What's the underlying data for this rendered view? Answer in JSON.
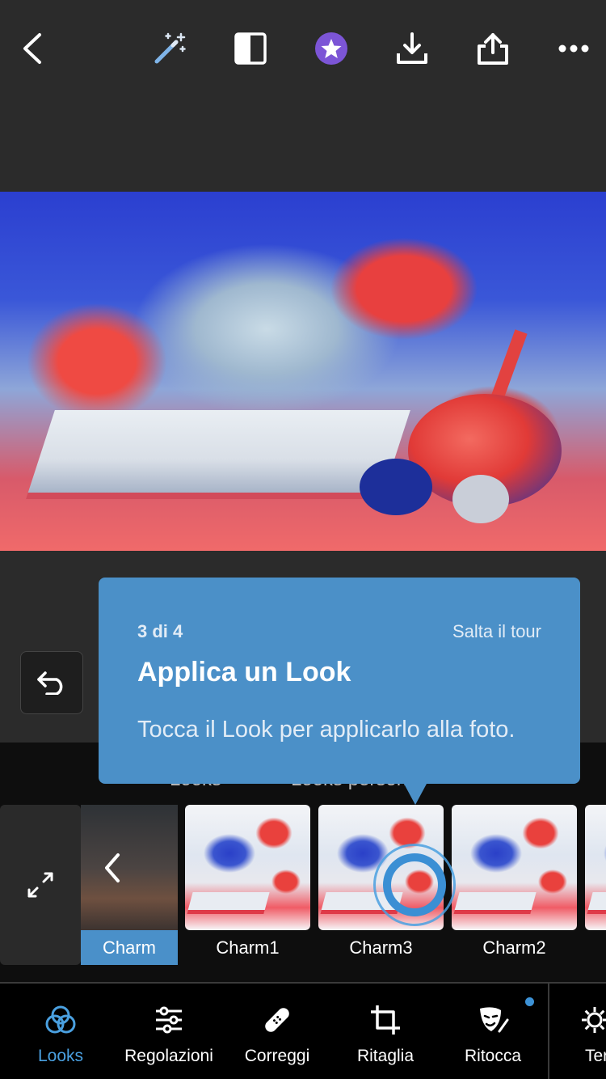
{
  "colors": {
    "accent": "#4a90c9",
    "tooltip_bg": "#4b90c8",
    "active_nav": "#4aa0e0",
    "premium": "#7c55d6"
  },
  "topbar": {
    "icons": [
      "back-icon",
      "magic-wand-icon",
      "compare-icon",
      "premium-star-icon",
      "download-icon",
      "share-icon",
      "more-icon"
    ]
  },
  "tooltip": {
    "step": "3 di 4",
    "skip": "Salta il tour",
    "title": "Applica un Look",
    "body": "Tocca il Look per applicarlo alla foto."
  },
  "looks_tabs": {
    "tab1": "Looks",
    "tab2": "Looks personali"
  },
  "looks": {
    "category": "Charm",
    "items": [
      "Charm1",
      "Charm3",
      "Charm2"
    ]
  },
  "bottom_nav": {
    "items": [
      {
        "label": "Looks",
        "icon": "looks-icon",
        "active": true
      },
      {
        "label": "Regolazioni",
        "icon": "sliders-icon"
      },
      {
        "label": "Correggi",
        "icon": "bandage-icon"
      },
      {
        "label": "Ritaglia",
        "icon": "crop-icon"
      },
      {
        "label": "Ritocca",
        "icon": "mask-brush-icon"
      },
      {
        "label": "Ter",
        "icon": "settings-icon"
      }
    ]
  }
}
